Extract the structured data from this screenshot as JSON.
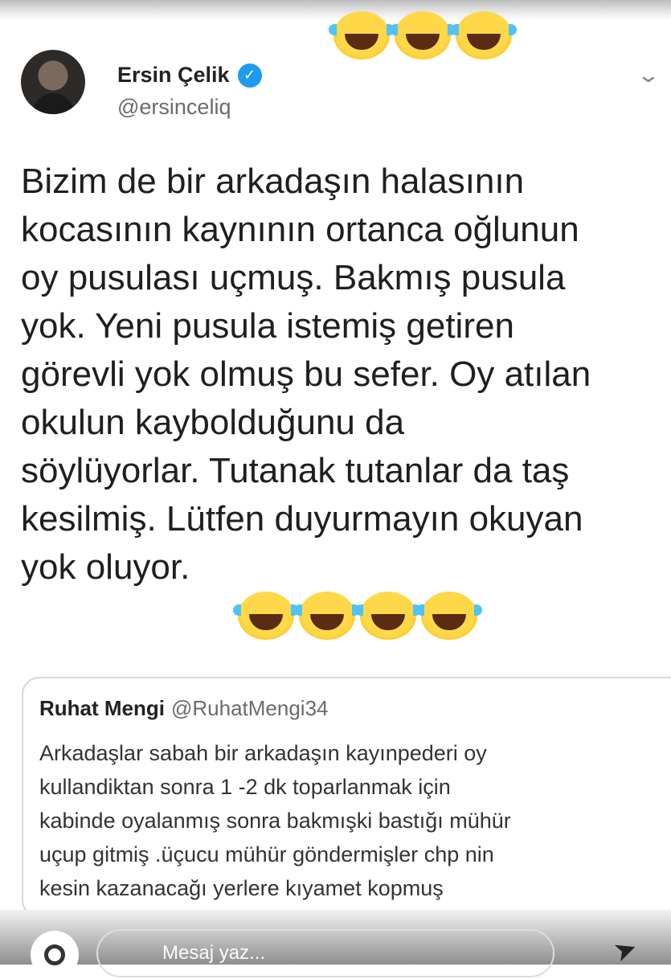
{
  "tweet": {
    "author_name": "Ersin Çelik",
    "author_handle": "@ersinceliq",
    "text_lines": [
      "Bizim de bir arkadaşın halasının",
      "kocasının kaynının ortanca oğlunun",
      "oy pusulası uçmuş. Bakmış pusula",
      "yok. Yeni pusula istemiş getiren",
      "görevli yok olmuş bu sefer. Oy atılan",
      "okulun kaybolduğunu da",
      "söylüyorlar. Tutanak tutanlar da taş",
      "kesilmiş. Lütfen duyurmayın okuyan",
      "yok oluyor."
    ],
    "verified_glyph": "✓",
    "menu_glyph": "⌄"
  },
  "quoted_tweet": {
    "author_name": "Ruhat Mengi",
    "author_handle": "@RuhatMengi34",
    "text_lines": [
      "Arkadaşlar sabah bir arkadaşın kayınpederi oy",
      "kullandiktan sonra 1 -2 dk toparlanmak için",
      "kabinde oyalanmış sonra bakmışki bastığı mühür",
      "uçup gitmiş .üçucu mühür göndermişler chp nin",
      "kesin kazanacağı yerlere kıyamet kopmuş"
    ]
  },
  "story_reply": {
    "placeholder": "Mesaj yaz...",
    "send_glyph": "➤"
  },
  "icons": {
    "avatar": "profile-photo",
    "verified": "verified-badge-icon",
    "menu": "chevron-down-icon",
    "emoji": "face-with-tears-of-joy-icon",
    "camera": "camera-icon",
    "send": "send-icon"
  },
  "colors": {
    "verified_blue": "#1d9bf0",
    "text": "#1f1f1f",
    "secondary_text": "#6b6b6b"
  }
}
